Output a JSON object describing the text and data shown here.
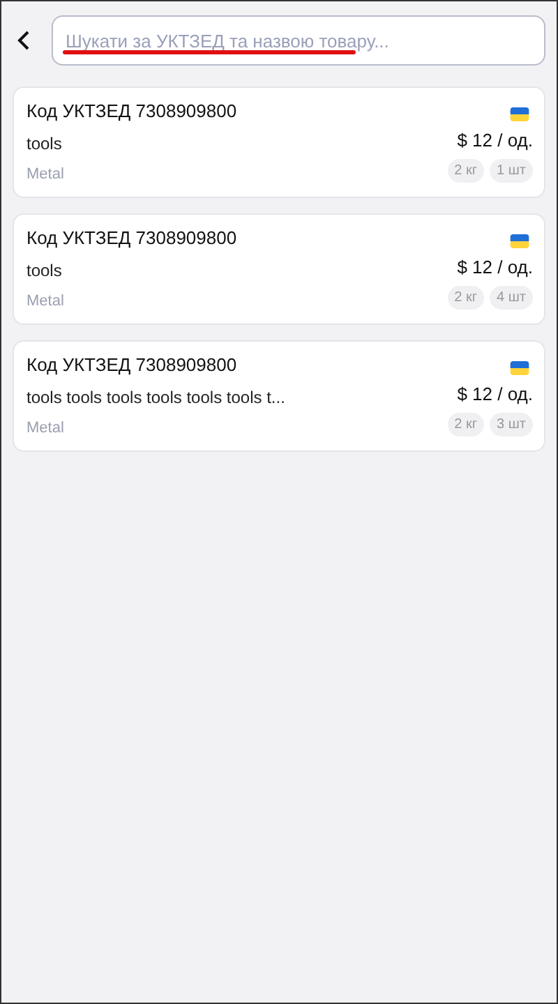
{
  "search": {
    "placeholder": "Шукати за УКТЗЕД та назвою товару..."
  },
  "products": [
    {
      "code": "Код УКТЗЕД 7308909800",
      "name": "tools",
      "material": "Metal",
      "price": "$ 12 / од.",
      "weight": "2 кг",
      "quantity": "1 шт"
    },
    {
      "code": "Код УКТЗЕД 7308909800",
      "name": "tools",
      "material": "Metal",
      "price": "$ 12 / од.",
      "weight": "2 кг",
      "quantity": "4 шт"
    },
    {
      "code": "Код УКТЗЕД 7308909800",
      "name": "tools tools tools tools tools tools t...",
      "material": "Metal",
      "price": "$ 12 / од.",
      "weight": "2 кг",
      "quantity": "3 шт"
    }
  ]
}
